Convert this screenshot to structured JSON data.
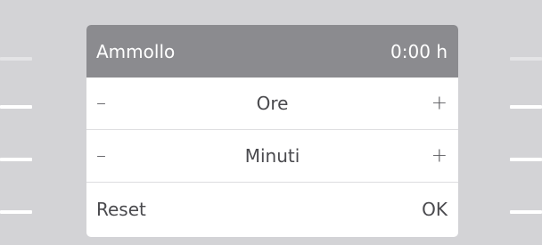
{
  "panel": {
    "title": "Ammollo",
    "time_value": "0:00 h",
    "hours_row": {
      "minus": "–",
      "label": "Ore",
      "plus": "+"
    },
    "minutes_row": {
      "minus": "–",
      "label": "Minuti",
      "plus": "+"
    },
    "footer": {
      "reset_label": "Reset",
      "ok_label": "OK"
    }
  },
  "colors": {
    "background": "#d3d3d6",
    "header": "#8b8b8f",
    "panel": "#ffffff",
    "text": "#4a4a4e"
  }
}
